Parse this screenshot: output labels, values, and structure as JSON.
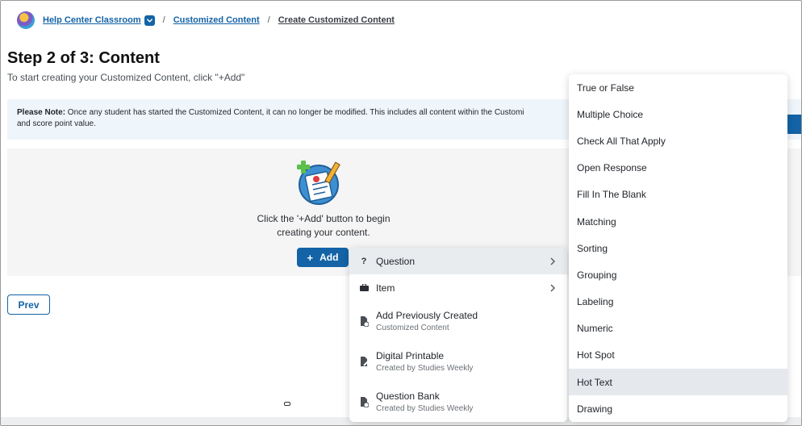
{
  "breadcrumb": {
    "classroom": "Help Center Classroom",
    "section": "Customized Content",
    "current": "Create Customized Content",
    "separator": "/"
  },
  "page": {
    "title": "Step 2 of 3: Content",
    "subtitle": "To start creating your Customized Content, click \"+Add\""
  },
  "note": {
    "label": "Please Note:",
    "text": " Once any student has started the Customized Content, it can no longer be modified. This includes all content within the Customi",
    "text_line2": "and score point value."
  },
  "empty_state": {
    "line1": "Click the '+Add' button to begin",
    "line2": "creating your content."
  },
  "buttons": {
    "add_plus": "+",
    "add": "Add",
    "prev": "Prev"
  },
  "add_menu": {
    "items": [
      {
        "label": "Question",
        "sub": "",
        "icon": "question-icon",
        "submenu": true,
        "selected": true
      },
      {
        "label": "Item",
        "sub": "",
        "icon": "briefcase-icon",
        "submenu": true,
        "selected": false
      },
      {
        "label": "Add Previously Created",
        "sub": "Customized Content",
        "icon": "file-clock-icon",
        "submenu": false,
        "selected": false
      },
      {
        "label": "Digital Printable",
        "sub": "Created by Studies Weekly",
        "icon": "file-edit-icon",
        "submenu": false,
        "selected": false
      },
      {
        "label": "Question Bank",
        "sub": "Created by Studies Weekly",
        "icon": "file-clock-icon",
        "submenu": false,
        "selected": false
      }
    ]
  },
  "question_menu": {
    "items": [
      "True or False",
      "Multiple Choice",
      "Check All That Apply",
      "Open Response",
      "Fill In The Blank",
      "Matching",
      "Sorting",
      "Grouping",
      "Labeling",
      "Numeric",
      "Hot Spot",
      "Hot Text",
      "Drawing"
    ],
    "selected": "Hot Text"
  },
  "colors": {
    "primary": "#1363a6",
    "note_bg": "#eef5fb",
    "card_bg": "#f5f5f6",
    "highlight": "#e5e9ed"
  }
}
